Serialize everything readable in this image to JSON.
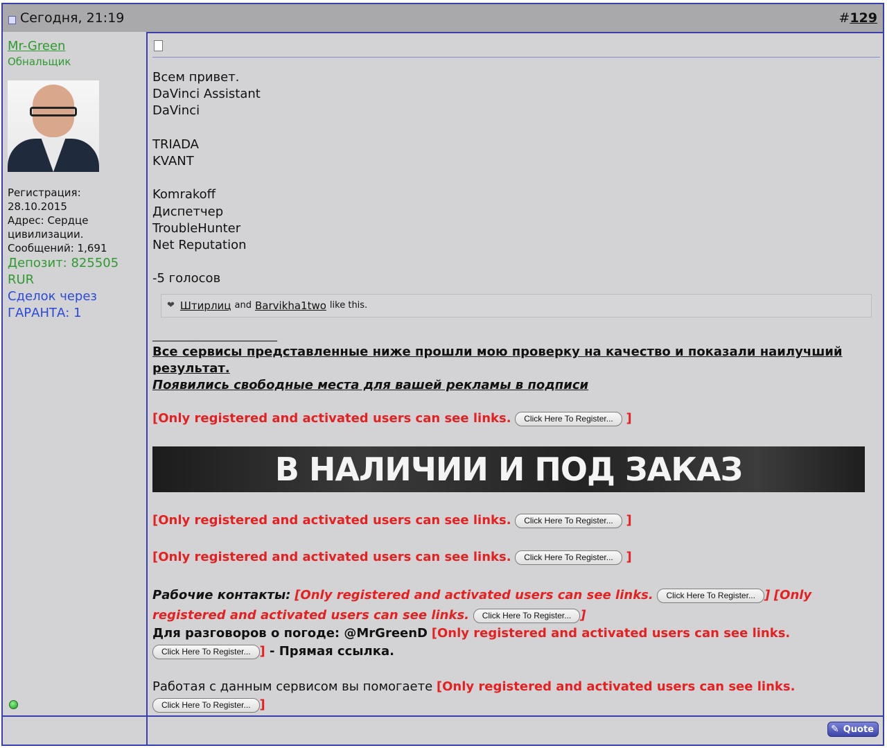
{
  "header": {
    "date": "Сегодня, 21:19",
    "post_hash": "#",
    "post_number": "129"
  },
  "user": {
    "name": "Mr-Green",
    "title": "Обнальщик",
    "reg_label": "Регистрация:",
    "reg_date": "28.10.2015",
    "address": "Адрес: Сердце цивилизации.",
    "messages": "Сообщений: 1,691",
    "deposit": "Депозит: 825505 RUR",
    "deals": "Сделок через ГАРАНТА: 1"
  },
  "body": {
    "lines": [
      "Всем привет.",
      "DaVinci Assistant",
      "DaVinci",
      "",
      "TRIADA",
      "KVANT",
      "",
      "Komrakoff",
      "Диспетчер",
      "TroubleHunter",
      "Net Reputation",
      "",
      "-5 голосов"
    ]
  },
  "likes": {
    "user1": "Штирлиц",
    "and": "and",
    "user2": "Barvikha1two",
    "suffix": "like this."
  },
  "signature": {
    "rule": "________________________",
    "bold_text": "Все сервисы представленные ниже прошли мою проверку на качество и показали наилучший результат.",
    "italic_text": "Появились свободные места для вашей рекламы в подписи ",
    "hidden_link": "[Only registered and activated users can see links.",
    "hidden_link_part1": "[Only",
    "hidden_link_part2": "registered and activated users can see links.",
    "close_bracket": "]",
    "register_btn": "Click Here To Register...",
    "banner": "В НАЛИЧИИ И ПОД ЗАКАЗ",
    "contacts_label": "Рабочие контакты:",
    "weather_label": "Для разговоров о погоде: @MrGreenD",
    "direct_link": " - Прямая ссылка.",
    "helping_text": "Работая с данным сервисом вы помогаете "
  },
  "footer": {
    "quote": "Quote"
  }
}
